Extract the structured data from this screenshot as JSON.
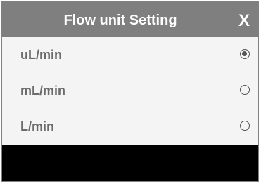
{
  "dialog": {
    "title": "Flow unit Setting",
    "close_label": "X"
  },
  "options": [
    {
      "label": "uL/min",
      "selected": true
    },
    {
      "label": "mL/min",
      "selected": false
    },
    {
      "label": "L/min",
      "selected": false
    }
  ],
  "colors": {
    "titlebar": "#7f7f7f",
    "background": "#f4f4f4",
    "label_text": "#6b6b6b",
    "footer": "#000000"
  }
}
